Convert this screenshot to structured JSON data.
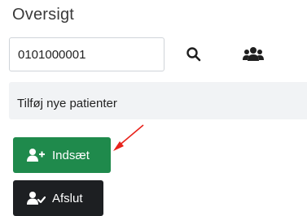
{
  "page": {
    "title": "Oversigt"
  },
  "search": {
    "value": "0101000001"
  },
  "toolbar": {
    "search_icon": "search-icon",
    "group_icon": "users-icon"
  },
  "panel": {
    "label": "Tilføj nye patienter"
  },
  "buttons": {
    "insert_label": "Indsæt",
    "insert_icon": "user-plus-icon",
    "insert_color": "#1f8a4c",
    "finish_label": "Afslut",
    "finish_icon": "user-check-icon",
    "finish_color": "#1d1f22"
  },
  "annotation": {
    "arrow_color": "#e8221b"
  }
}
